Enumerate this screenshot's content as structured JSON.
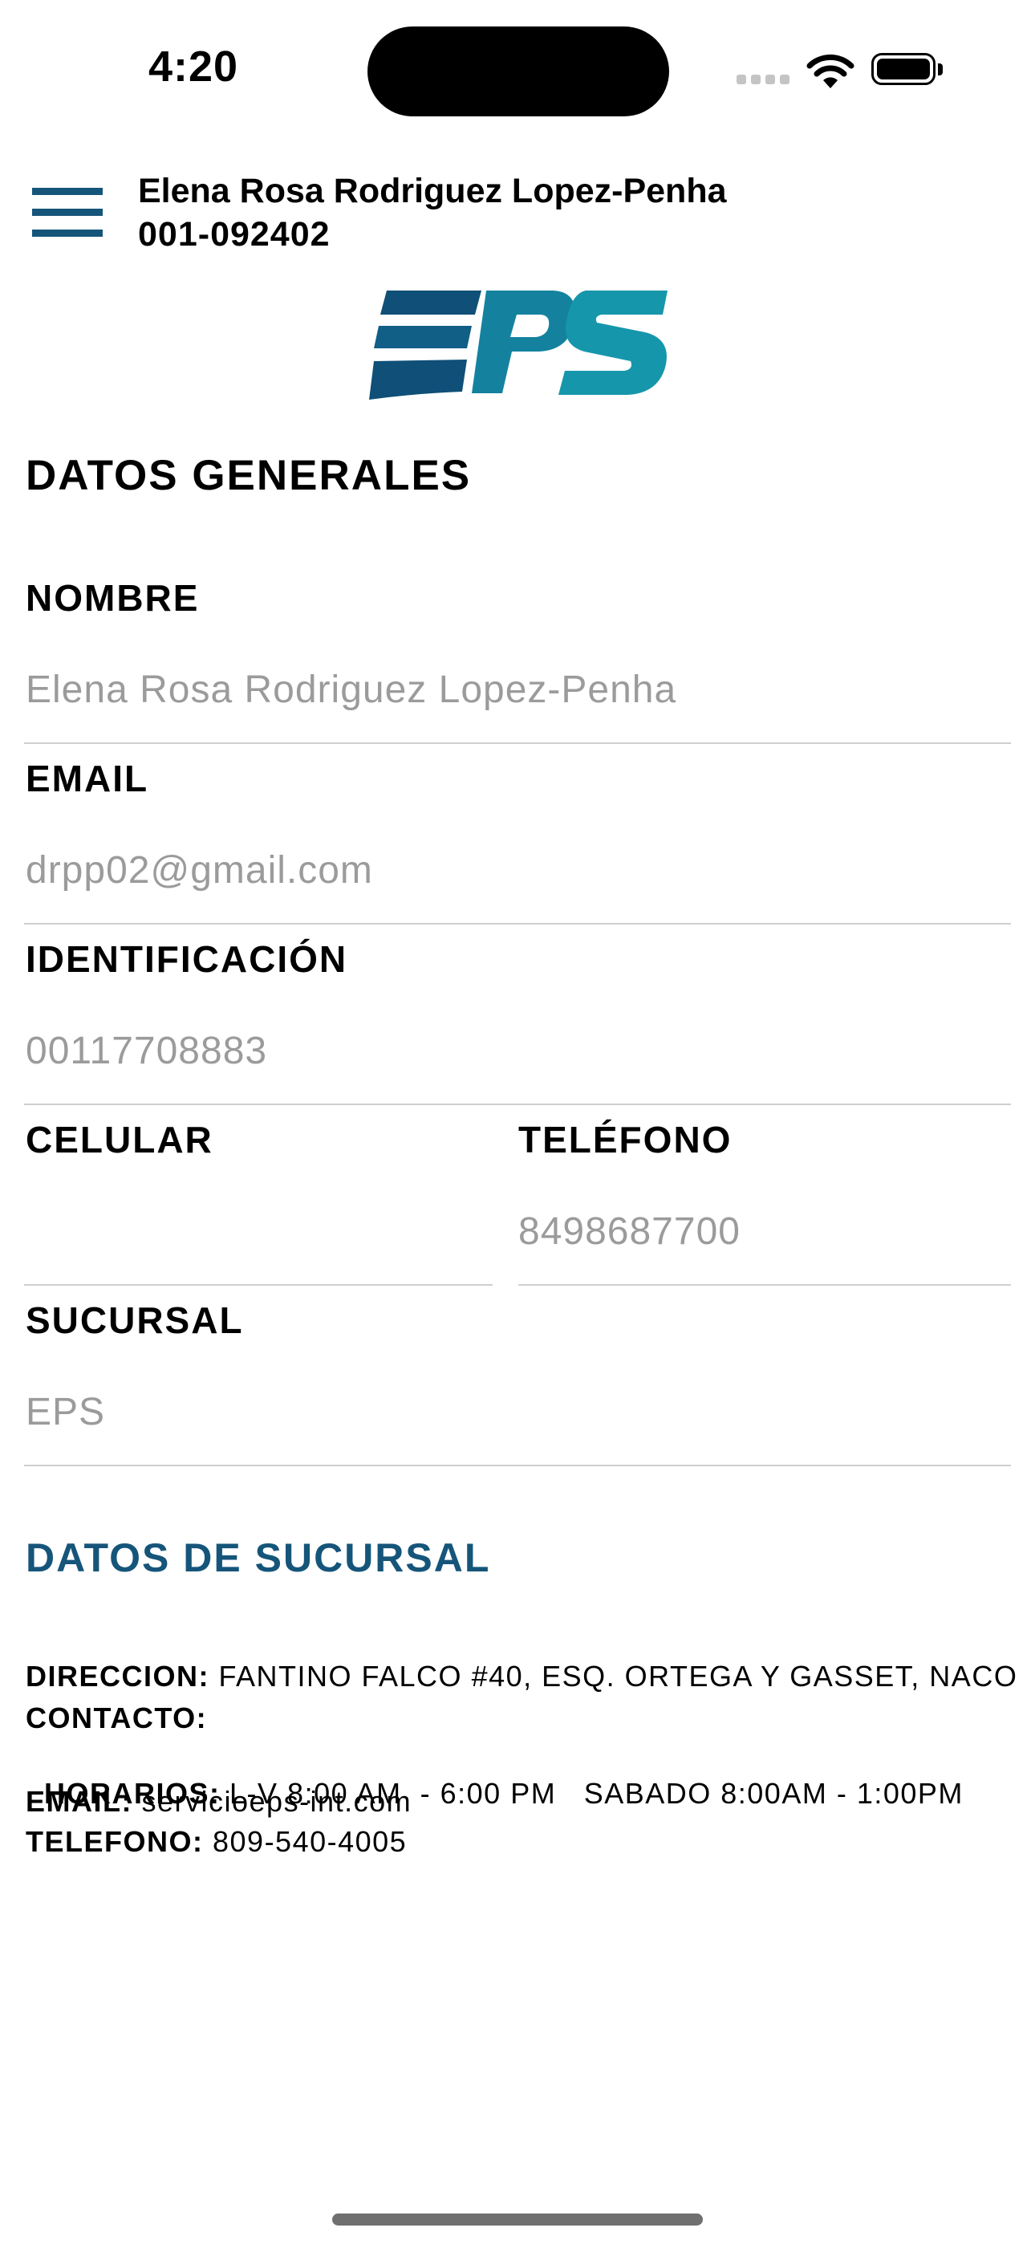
{
  "status_bar": {
    "time": "4:20"
  },
  "header": {
    "user_name": "Elena Rosa Rodriguez Lopez-Penha",
    "user_id": "001-092402",
    "logo_text": "EPS",
    "brand_colors": {
      "dark": "#0f4f78",
      "light": "#1696ab"
    }
  },
  "general": {
    "title": "DATOS GENERALES",
    "nombre": {
      "label": "NOMBRE",
      "value": "Elena Rosa Rodriguez Lopez-Penha"
    },
    "email": {
      "label": "EMAIL",
      "value": "drpp02@gmail.com"
    },
    "identificacion": {
      "label": "IDENTIFICACIÓN",
      "value": "00117708883"
    },
    "celular": {
      "label": "CELULAR",
      "value": ""
    },
    "telefono": {
      "label": "TELÉFONO",
      "value": "8498687700"
    },
    "sucursal": {
      "label": "SUCURSAL",
      "value": "EPS"
    }
  },
  "branch": {
    "title": "DATOS DE SUCURSAL",
    "direccion": {
      "label": "DIRECCION:",
      "value": "FANTINO FALCO #40, ESQ. ORTEGA Y GASSET, NACO"
    },
    "contacto": {
      "label": "CONTACTO:",
      "value": ""
    },
    "horarios": {
      "label": "HORARIOS:",
      "value": "L-V 8:00 AM  - 6:00 PM   SABADO 8:00AM - 1:00PM"
    },
    "email": {
      "label": "EMAIL:",
      "value": "servicioeps-int.com"
    },
    "telefono": {
      "label": "TELEFONO:",
      "value": "809-540-4005"
    }
  },
  "colors": {
    "accent": "#16557a",
    "value_text": "#9b9b9b",
    "divider": "#cfcfcf"
  }
}
